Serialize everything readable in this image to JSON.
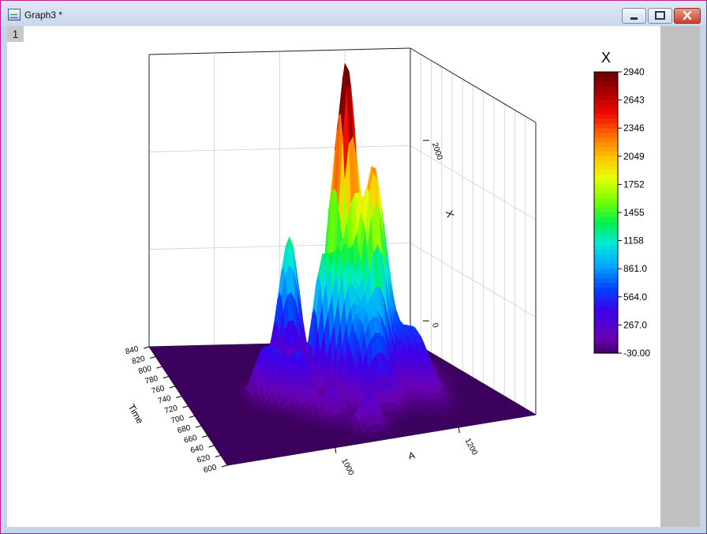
{
  "window": {
    "title": "Graph3 *",
    "page_number": "1",
    "buttons": {
      "minimize": "minimize-icon",
      "maximize": "maximize-icon",
      "close": "close-icon"
    }
  },
  "chart_data": {
    "type": "surface",
    "title": "",
    "xlabel": "A",
    "ylabel": "Time",
    "zlabel": "X",
    "x_ticks": [
      "1000",
      "1200"
    ],
    "y_ticks": [
      "600",
      "620",
      "640",
      "660",
      "680",
      "700",
      "720",
      "740",
      "760",
      "780",
      "800",
      "820",
      "840"
    ],
    "y_range": [
      600,
      840
    ],
    "z_ticks": [
      "0",
      "2000"
    ],
    "z_range": [
      -300,
      2940
    ],
    "grid": true,
    "colormap": "rainbow",
    "colorbar": {
      "title": "X",
      "labels": [
        "2940",
        "2643",
        "2346",
        "2049",
        "1752",
        "1455",
        "1158",
        "861.0",
        "564.0",
        "267.0",
        "-30.00"
      ],
      "values": [
        2940,
        2643,
        2346,
        2049,
        1752,
        1455,
        1158,
        861,
        564,
        267,
        -30
      ]
    },
    "peaks": [
      {
        "x": 0.58,
        "y": 0.55,
        "z": 2940,
        "w": 0.03,
        "d": 0.04
      },
      {
        "x": 0.63,
        "y": 0.45,
        "z": 2300,
        "w": 0.035,
        "d": 0.05
      },
      {
        "x": 0.56,
        "y": 0.63,
        "z": 2050,
        "w": 0.03,
        "d": 0.05
      },
      {
        "x": 0.53,
        "y": 0.45,
        "z": 1480,
        "w": 0.03,
        "d": 0.05
      },
      {
        "x": 0.47,
        "y": 0.5,
        "z": 1400,
        "w": 0.03,
        "d": 0.05
      },
      {
        "x": 0.68,
        "y": 0.52,
        "z": 1350,
        "w": 0.03,
        "d": 0.05
      },
      {
        "x": 0.44,
        "y": 0.72,
        "z": 1150,
        "w": 0.028,
        "d": 0.045
      },
      {
        "x": 0.4,
        "y": 0.68,
        "z": 900,
        "w": 0.03,
        "d": 0.05
      },
      {
        "x": 0.55,
        "y": 0.32,
        "z": 700,
        "w": 0.04,
        "d": 0.06
      },
      {
        "x": 0.6,
        "y": 0.3,
        "z": 650,
        "w": 0.04,
        "d": 0.06
      },
      {
        "x": 0.7,
        "y": 0.7,
        "z": 900,
        "w": 0.04,
        "d": 0.05
      },
      {
        "x": 0.66,
        "y": 0.82,
        "z": 700,
        "w": 0.035,
        "d": 0.05
      },
      {
        "x": 0.36,
        "y": 0.4,
        "z": 600,
        "w": 0.03,
        "d": 0.06
      },
      {
        "x": 0.3,
        "y": 0.45,
        "z": 450,
        "w": 0.025,
        "d": 0.05
      },
      {
        "x": 0.26,
        "y": 0.5,
        "z": 480,
        "w": 0.025,
        "d": 0.05
      },
      {
        "x": 0.49,
        "y": 0.85,
        "z": 450,
        "w": 0.03,
        "d": 0.04
      },
      {
        "x": 0.5,
        "y": 0.12,
        "z": 400,
        "w": 0.03,
        "d": 0.04
      },
      {
        "x": 0.42,
        "y": 0.25,
        "z": 350,
        "w": 0.03,
        "d": 0.04
      },
      {
        "x": 0.75,
        "y": 0.4,
        "z": 700,
        "w": 0.04,
        "d": 0.1
      },
      {
        "x": 0.82,
        "y": 0.7,
        "z": 450,
        "w": 0.05,
        "d": 0.15
      }
    ]
  }
}
